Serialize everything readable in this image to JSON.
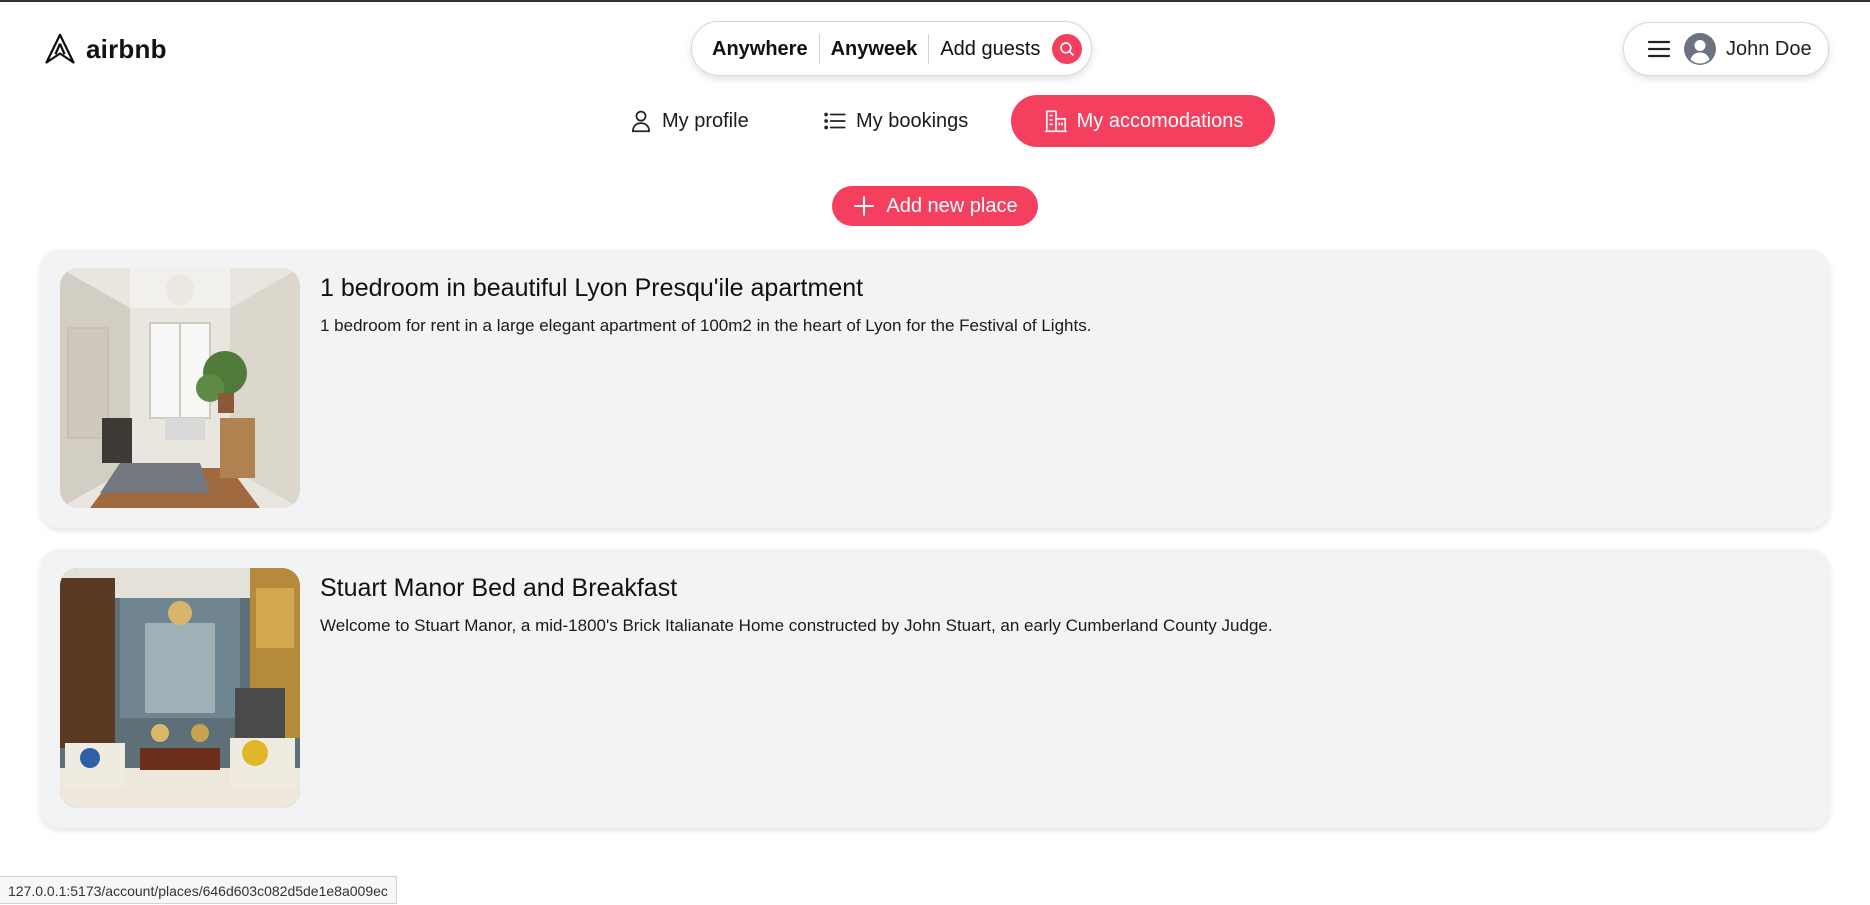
{
  "brand": {
    "logo_text": "airbnb",
    "accent": "#f43f5e"
  },
  "search": {
    "where": "Anywhere",
    "when": "Anyweek",
    "guests": "Add guests",
    "icon": "search-icon"
  },
  "user": {
    "name": "John Doe",
    "menu_icon": "hamburger-icon",
    "avatar_icon": "user-avatar-icon"
  },
  "nav": {
    "items": [
      {
        "label": "My profile",
        "icon": "user-icon",
        "active": false
      },
      {
        "label": "My bookings",
        "icon": "list-icon",
        "active": false
      },
      {
        "label": "My accomodations",
        "icon": "building-icon",
        "active": true
      }
    ]
  },
  "actions": {
    "add_place_label": "Add new place",
    "add_icon": "plus-icon"
  },
  "places": [
    {
      "title": "1 bedroom in beautiful Lyon Presqu'ile apartment",
      "description": "1 bedroom for rent in a large elegant apartment of 100m2 in the heart of Lyon for the Festival of Lights."
    },
    {
      "title": "Stuart Manor Bed and Breakfast",
      "description": "Welcome to Stuart Manor, a mid-1800's Brick Italianate Home constructed by John Stuart, an early Cumberland County Judge."
    }
  ],
  "status_bar": {
    "url": "127.0.0.1:5173/account/places/646d603c082d5de1e8a009ec"
  }
}
